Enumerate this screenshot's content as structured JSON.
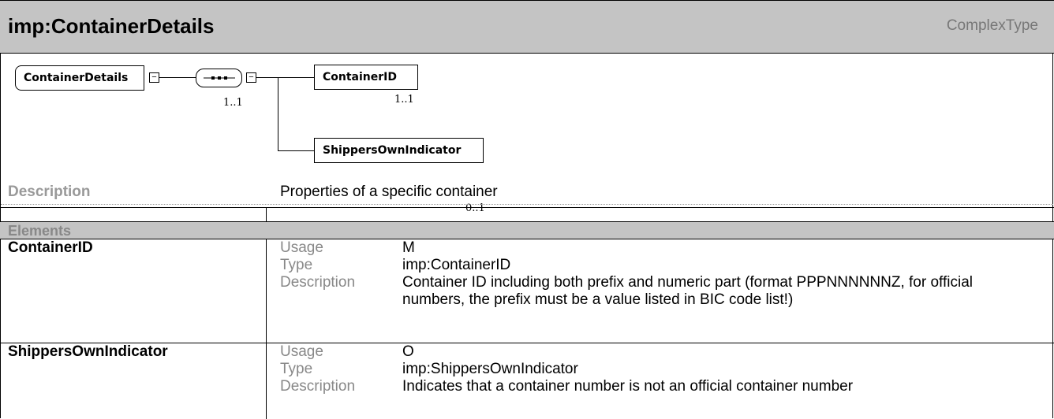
{
  "header": {
    "title": "imp:ContainerDetails",
    "kind": "ComplexType"
  },
  "diagram": {
    "root": {
      "label": "ContainerDetails"
    },
    "sequence": {
      "cardinality": "1..1"
    },
    "children": [
      {
        "label": "ContainerID",
        "cardinality": "1..1"
      },
      {
        "label": "ShippersOwnIndicator",
        "cardinality": "0..1"
      }
    ],
    "collapse_symbol": "−"
  },
  "description": {
    "label": "Description",
    "text": "Properties of a specific container"
  },
  "elements_section": {
    "heading": "Elements",
    "rows": [
      {
        "name": "ContainerID",
        "props": [
          {
            "key": "Usage",
            "value": "M"
          },
          {
            "key": "Type",
            "value": "imp:ContainerID"
          },
          {
            "key": "Description",
            "value": "Container ID including both prefix and numeric part (format PPPNNNNNNZ, for official numbers, the prefix must be a value listed in BIC code list!)"
          }
        ]
      },
      {
        "name": "ShippersOwnIndicator",
        "props": [
          {
            "key": "Usage",
            "value": "O"
          },
          {
            "key": "Type",
            "value": "imp:ShippersOwnIndicator"
          },
          {
            "key": "Description",
            "value": "Indicates that a container number is not an official container number"
          }
        ]
      }
    ]
  }
}
